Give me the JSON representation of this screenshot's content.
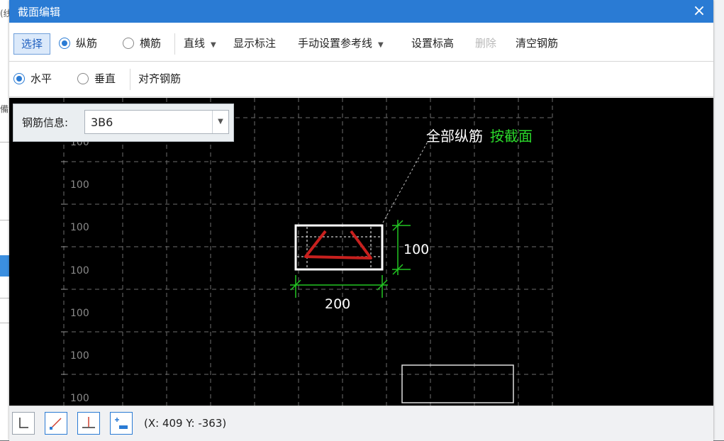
{
  "window": {
    "title": "截面编辑",
    "close_symbol": "×"
  },
  "toolbar1": {
    "select": "选择",
    "radio_longitudinal": "纵筋",
    "radio_transverse": "横筋",
    "line": "直线",
    "show_annotation": "显示标注",
    "manual_ref_line": "手动设置参考线",
    "set_elevation": "设置标高",
    "delete": "删除",
    "clear_rebar": "清空钢筋",
    "dropdown_symbol": "▼"
  },
  "toolbar2": {
    "radio_horizontal": "水平",
    "radio_vertical": "垂直",
    "align_rebar": "对齐钢筋"
  },
  "rebar_info": {
    "label": "钢筋信息:",
    "value": "3B6",
    "dropdown_symbol": "▼"
  },
  "canvas": {
    "grid_labels": [
      "100",
      "100",
      "100",
      "100",
      "100",
      "100",
      "100"
    ],
    "callout_part1": "全部纵筋",
    "callout_part2": "按截面",
    "dim_height": "100",
    "dim_width": "200",
    "colors": {
      "background": "#000000",
      "grid": "#6e6e6e",
      "rebar": "#c8201e",
      "dimension": "#22c622",
      "callout_highlight": "#2bd82b"
    }
  },
  "statusbar": {
    "tool_icons": [
      "ortho-icon",
      "snap-line-icon",
      "perpendicular-icon",
      "ref-point-icon"
    ],
    "coords": "(X: 409 Y: -363)"
  },
  "background_app": {
    "left_tags": [
      "(线",
      "備"
    ]
  }
}
